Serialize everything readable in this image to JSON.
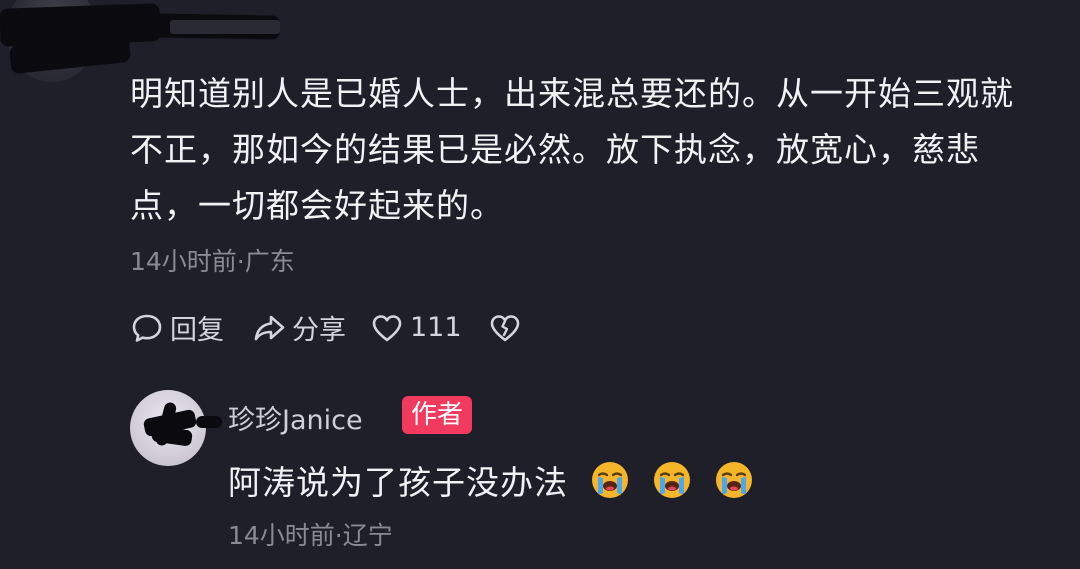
{
  "comment": {
    "lines": [
      "明知道别人是已婚人士，出来混总要还的。从一开始三观就",
      "不正，那如今的结果已是必然。放下执念，放宽心，慈悲",
      "点，一切都会好起来的。"
    ],
    "meta": "14小时前·广东",
    "actions": {
      "reply_label": "回复",
      "share_label": "分享",
      "like_count": "111"
    }
  },
  "reply": {
    "author": "珍珍Janice",
    "badge": "作者",
    "text": "阿涛说为了孩子没办法",
    "emojis": [
      "crying-face-icon",
      "crying-face-icon",
      "crying-face-icon"
    ],
    "meta": "14小时前·辽宁"
  },
  "colors": {
    "background": "#1f1f29",
    "badge": "#f23a5e",
    "meta_text": "#8a8a96"
  }
}
